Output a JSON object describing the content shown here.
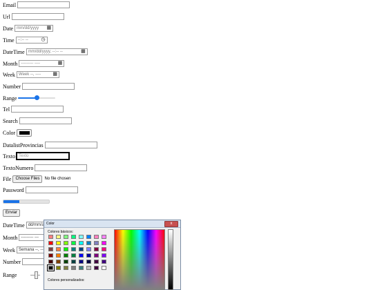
{
  "form": {
    "email_label": "Email",
    "url_label": "Url",
    "date_label": "Date",
    "date_placeholder": "mm/dd/yyyy",
    "time_label": "Time",
    "time_placeholder": "--:-- --",
    "datetime_label": "DateTime",
    "datetime_placeholder": "mm/dd/yyyy, --:-- --",
    "month_label": "Month",
    "month_placeholder": "--------- ----",
    "week_label": "Week",
    "week_placeholder": "Week --, ----",
    "number_label": "Number",
    "range_label": "Range",
    "range_value_fraction": 0.5,
    "tel_label": "Tel",
    "search_label": "Search",
    "color_label": "Color",
    "color_value": "#000000",
    "datalist_label": "DatalistProvincias",
    "texto_label": "Texto",
    "texto_placeholder": "Texto",
    "textonumero_label": "TextoNumero",
    "file_label": "File",
    "file_button": "Choose Files",
    "file_status": "No file chosen",
    "password_label": "Password",
    "progress_fraction": 0.35,
    "submit_button": "Enviar"
  },
  "form2": {
    "datetime_label": "DateTime",
    "datetime_placeholder": "dd/mm/aaa",
    "month_label": "Month",
    "month_placeholder": "---------  ---",
    "week_label": "Week",
    "week_placeholder": "Semana --, ---",
    "number_label": "Number",
    "range_label": "Range"
  },
  "color_dialog": {
    "title": "Color",
    "close_symbol": "x",
    "basic_colors_label": "Colores básicos:",
    "custom_colors_label": "Colores personalizados:",
    "basic_colors": [
      "#ff8080",
      "#ffff80",
      "#80ff80",
      "#00ff80",
      "#80ffff",
      "#0080ff",
      "#ff80c0",
      "#ff80ff",
      "#ff0000",
      "#ffff00",
      "#80ff00",
      "#00ff40",
      "#00ffff",
      "#0080c0",
      "#8080c0",
      "#ff00ff",
      "#804040",
      "#ff8040",
      "#00ff00",
      "#008080",
      "#004080",
      "#8080ff",
      "#800040",
      "#ff0080",
      "#800000",
      "#ff8000",
      "#008000",
      "#008040",
      "#0000ff",
      "#0000a0",
      "#800080",
      "#8000ff",
      "#400000",
      "#804000",
      "#004000",
      "#004040",
      "#000080",
      "#000040",
      "#400040",
      "#400080",
      "#000000",
      "#808000",
      "#808040",
      "#808080",
      "#408080",
      "#c0c0c0",
      "#400040",
      "#ffffff"
    ],
    "selected_index": 40
  }
}
